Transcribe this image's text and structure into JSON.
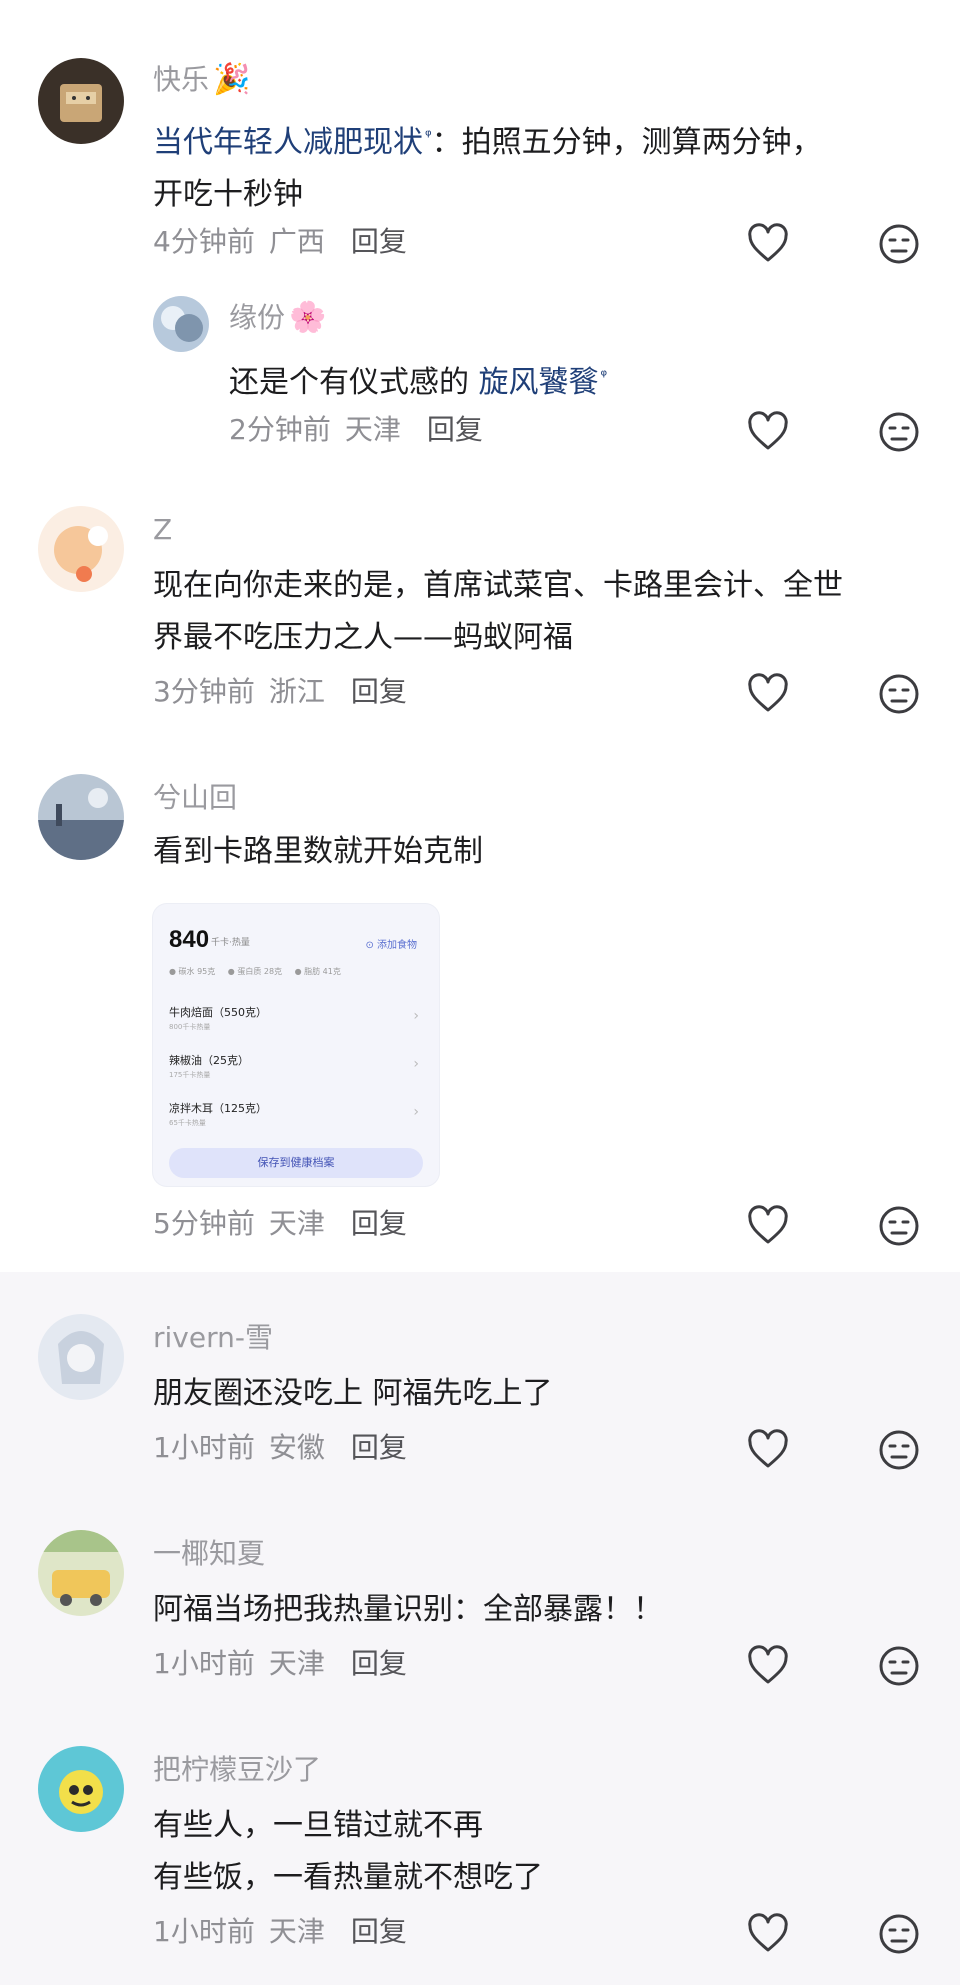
{
  "colors": {
    "link": "#1f3f78",
    "name": "#9a9a9f",
    "meta": "#8f8f94",
    "icon": "#3c3c40"
  },
  "comments": [
    {
      "name": "快乐",
      "name_emoji": "🎉",
      "link_text": "当代年轻人减肥现状",
      "text": "：拍照五分钟，测算两分钟，\n开吃十秒钟",
      "time": "4分钟前",
      "location": "广西",
      "reply_label": "回复"
    },
    {
      "name": "缘份",
      "name_emoji": "🌸",
      "text": "还是个有仪式感的 ",
      "link_text": "旋风饕餮",
      "time": "2分钟前",
      "location": "天津",
      "reply_label": "回复"
    },
    {
      "name": "Z",
      "text": "现在向你走来的是，首席试菜官、卡路里会计、全世\n界最不吃压力之人——蚂蚁阿福",
      "time": "3分钟前",
      "location": "浙江",
      "reply_label": "回复"
    },
    {
      "name": "兮山回",
      "text": "看到卡路里数就开始克制",
      "time": "5分钟前",
      "location": "天津",
      "reply_label": "回复",
      "image_card": {
        "calories": "840",
        "calories_unit": "千卡·热量",
        "add_food": "⊙ 添加食物",
        "macros": [
          "● 碳水 95克",
          "● 蛋白质 28克",
          "● 脂肪 41克"
        ],
        "items": [
          {
            "food": "牛肉焙面（550克）",
            "kcal": "800千卡热量"
          },
          {
            "food": "辣椒油（25克）",
            "kcal": "175千卡热量"
          },
          {
            "food": "凉拌木耳（125克）",
            "kcal": "65千卡热量"
          }
        ],
        "save_label": "保存到健康档案"
      }
    },
    {
      "name": "rivern-雪",
      "text": "朋友圈还没吃上 阿福先吃上了",
      "time": "1小时前",
      "location": "安徽",
      "reply_label": "回复"
    },
    {
      "name": "一椰知夏",
      "text": "阿福当场把我热量识别：全部暴露！！",
      "time": "1小时前",
      "location": "天津",
      "reply_label": "回复"
    },
    {
      "name": "把柠檬豆沙了",
      "text": "有些人，一旦错过就不再\n有些饭，一看热量就不想吃了",
      "time": "1小时前",
      "location": "天津",
      "reply_label": "回复"
    }
  ]
}
